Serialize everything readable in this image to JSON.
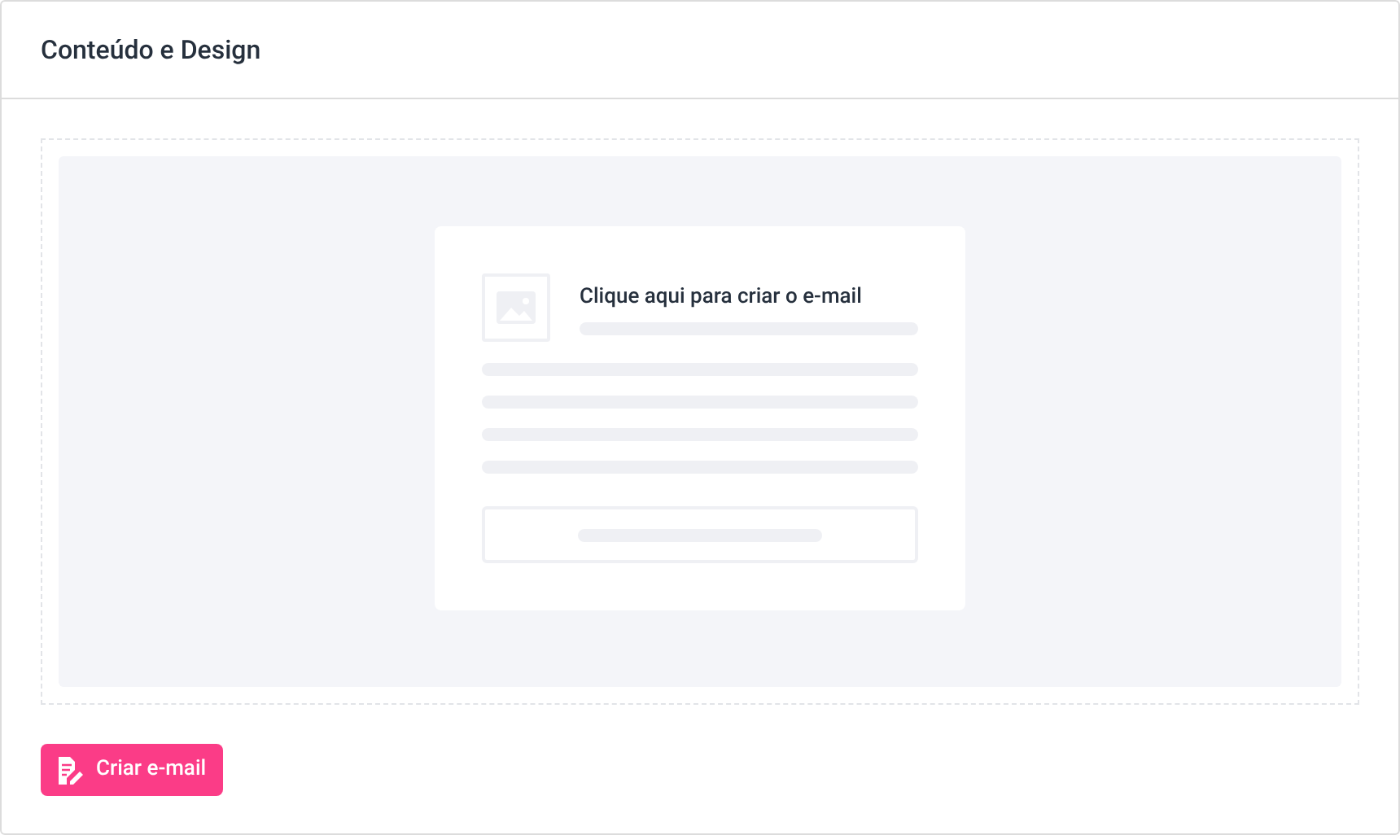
{
  "panel": {
    "title": "Conteúdo e Design"
  },
  "placeholder": {
    "prompt": "Clique aqui para criar o e-mail"
  },
  "create_button": {
    "label": "Criar e-mail"
  }
}
